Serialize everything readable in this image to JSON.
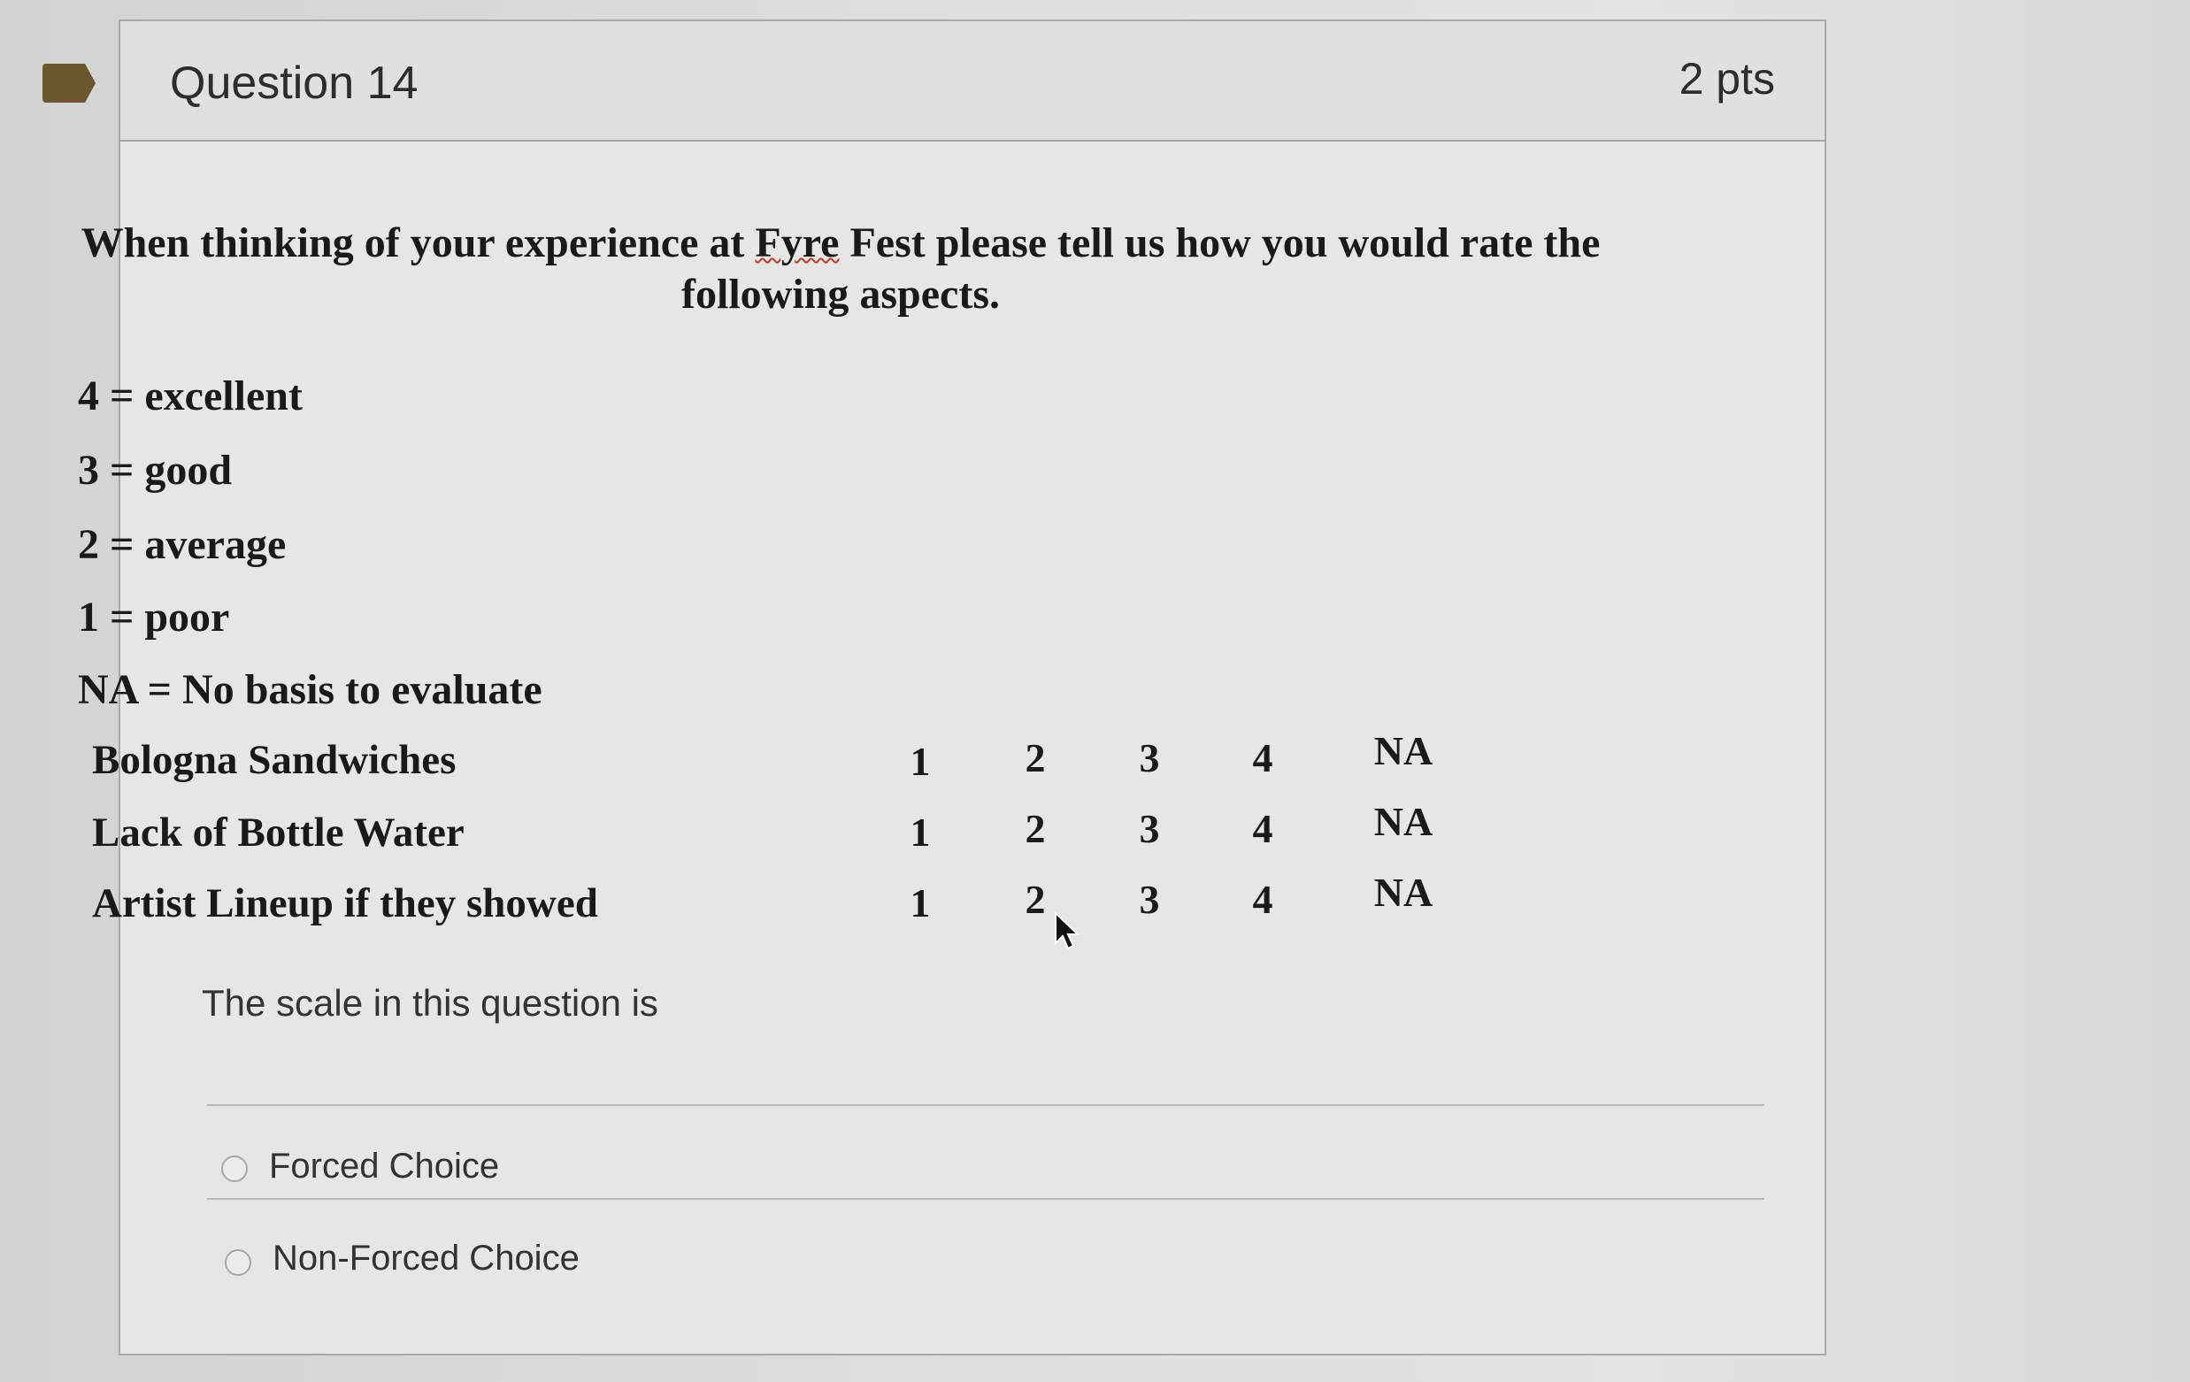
{
  "question": {
    "title": "Question 14",
    "points": "2 pts"
  },
  "prompt": {
    "before": "When thinking of your experience at ",
    "underlined": "Fyre",
    "after": " Fest please tell us how you would rate the following aspects."
  },
  "legend": [
    "4 = excellent",
    "3 = good",
    "2 = average",
    "1 = poor",
    "NA = No basis to evaluate"
  ],
  "scale_values": [
    "1",
    "2",
    "3",
    "4",
    "NA"
  ],
  "items": [
    "Bologna Sandwiches",
    "Lack of Bottle Water",
    "Artist Lineup if they showed"
  ],
  "question_text": "The scale in this question is",
  "options": [
    "Forced Choice",
    "Non-Forced Choice"
  ],
  "colors": {
    "tag": "#6b5630",
    "background": "#dcdddd",
    "card": "#e6e6e5"
  }
}
